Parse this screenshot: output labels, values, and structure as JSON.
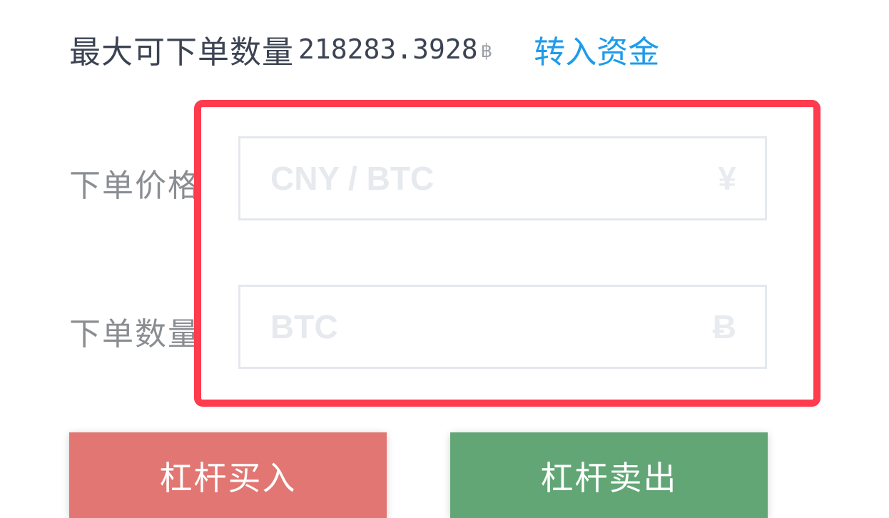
{
  "header": {
    "max_order_label": "最大可下单数量",
    "max_order_value": "218283.3928",
    "max_order_unit": "฿",
    "transfer_link": "转入资金"
  },
  "form": {
    "price": {
      "label": "下单价格",
      "placeholder": "CNY / BTC",
      "unit_symbol": "¥"
    },
    "quantity": {
      "label": "下单数量",
      "placeholder": "BTC",
      "unit_symbol": "Ƀ"
    }
  },
  "actions": {
    "buy_label": "杠杆买入",
    "sell_label": "杠杆卖出"
  },
  "colors": {
    "highlight_border": "#ff3b4e",
    "link": "#1e9bea",
    "buy": "#e17672",
    "sell": "#62a676"
  },
  "icons": {
    "max_unit": "baht-sign-icon",
    "price_unit": "yen-sign-icon",
    "quantity_unit": "bitcoin-sign-icon"
  }
}
